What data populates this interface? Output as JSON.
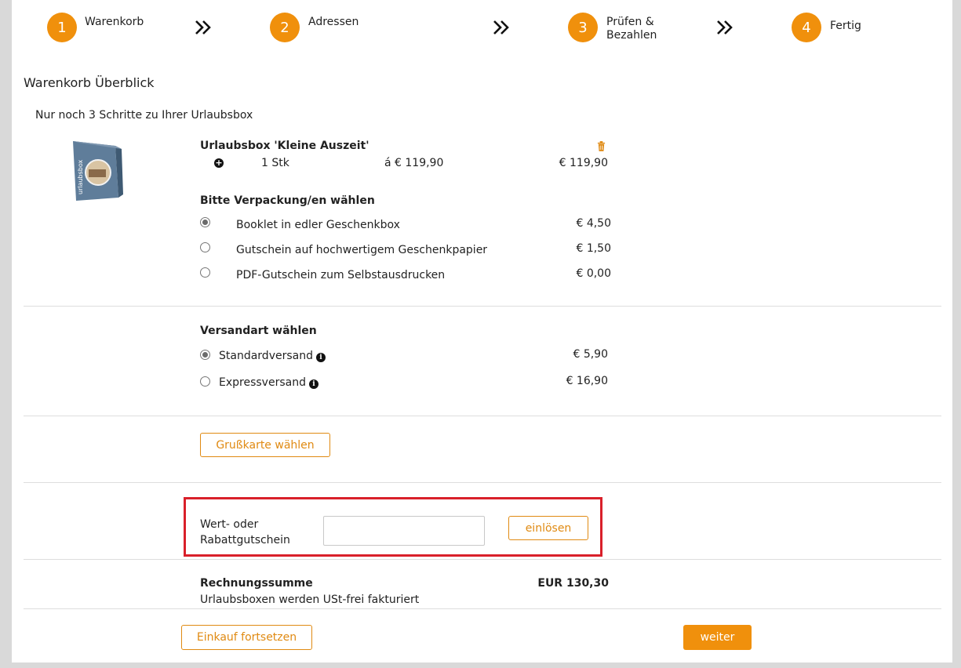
{
  "steps": [
    {
      "number": "1",
      "label": "Warenkorb"
    },
    {
      "number": "2",
      "label": "Adressen"
    },
    {
      "number": "3",
      "label_line1": "Prüfen &",
      "label_line2": "Bezahlen"
    },
    {
      "number": "4",
      "label": "Fertig"
    }
  ],
  "page_title": "Warenkorb Überblick",
  "subtitle": "Nur noch 3 Schritte zu Ihrer Urlaubsbox",
  "product": {
    "name": "Urlaubsbox 'Kleine Auszeit'",
    "quantity": "1 Stk",
    "unit_price": "á € 119,90",
    "total": "€ 119,90",
    "image_brand": "urlaubsbox"
  },
  "packaging": {
    "heading": "Bitte Verpackung/en wählen",
    "options": [
      {
        "label": "Booklet in edler Geschenkbox",
        "price": "€ 4,50",
        "selected": true
      },
      {
        "label": "Gutschein auf hochwertigem Geschenkpapier",
        "price": "€ 1,50",
        "selected": false
      },
      {
        "label": "PDF-Gutschein zum Selbstausdrucken",
        "price": "€ 0,00",
        "selected": false
      }
    ]
  },
  "shipping": {
    "heading": "Versandart wählen",
    "options": [
      {
        "label": "Standardversand",
        "price": "€ 5,90",
        "selected": true
      },
      {
        "label": "Expressversand",
        "price": "€ 16,90",
        "selected": false
      }
    ]
  },
  "greeting_card_button": "Grußkarte wählen",
  "voucher": {
    "label_line1": "Wert- oder",
    "label_line2": "Rabattgutschein",
    "input_value": "",
    "redeem_button": "einlösen"
  },
  "summary": {
    "label": "Rechnungssumme",
    "amount": "EUR 130,30",
    "note": "Urlaubsboxen werden USt-frei fakturiert"
  },
  "footer": {
    "continue_shopping": "Einkauf fortsetzen",
    "next": "weiter"
  },
  "colors": {
    "accent": "#f0900c",
    "highlight_border": "#d9202a"
  }
}
